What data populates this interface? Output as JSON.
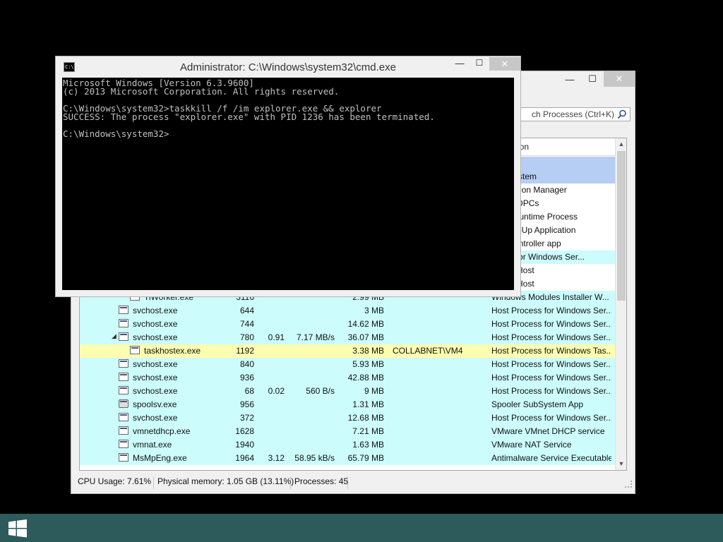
{
  "process_explorer": {
    "window_buttons": {
      "minimize": "—",
      "maximize": "☐",
      "close": "✕"
    },
    "search_placeholder": "ch Processes (Ctrl+K)",
    "header": {
      "description": "ion"
    },
    "rows": [
      {
        "name": "",
        "pid": "",
        "cpu": "",
        "io": "",
        "mem": "",
        "user": "",
        "desc": "",
        "style": "sel",
        "indent": 0,
        "icon": "none"
      },
      {
        "name": "",
        "pid": "",
        "cpu": "",
        "io": "",
        "mem": "",
        "user": "",
        "desc": "el & System",
        "style": "sel",
        "indent": 0,
        "icon": "none"
      },
      {
        "name": "",
        "pid": "",
        "cpu": "",
        "io": "",
        "mem": "",
        "user": "",
        "desc": "rs Session Manager",
        "style": "white",
        "indent": 0,
        "icon": "none"
      },
      {
        "name": "",
        "pid": "",
        "cpu": "",
        "io": "",
        "mem": "",
        "user": "",
        "desc": "ts and DPCs",
        "style": "white",
        "indent": 0,
        "icon": "none"
      },
      {
        "name": "",
        "pid": "",
        "cpu": "",
        "io": "",
        "mem": "",
        "user": "",
        "desc": "erver Runtime Process",
        "style": "white",
        "indent": 0,
        "icon": "none"
      },
      {
        "name": "",
        "pid": "",
        "cpu": "",
        "io": "",
        "mem": "",
        "user": "",
        "desc": "rs Start-Up Application",
        "style": "white",
        "indent": 0,
        "icon": "none"
      },
      {
        "name": "",
        "pid": "",
        "cpu": "",
        "io": "",
        "mem": "",
        "user": "",
        "desc": " and Controller app",
        "style": "white",
        "indent": 0,
        "icon": "none"
      },
      {
        "name": "",
        "pid": "",
        "cpu": "",
        "io": "",
        "mem": "",
        "user": "",
        "desc": "ocess for Windows Ser...",
        "style": "plain",
        "indent": 0,
        "icon": "none"
      },
      {
        "name": "",
        "pid": "",
        "cpu": "",
        "io": "",
        "mem": "",
        "user": "",
        "desc": "ovider Host",
        "style": "white",
        "indent": 0,
        "icon": "none"
      },
      {
        "name": "",
        "pid": "",
        "cpu": "",
        "io": "",
        "mem": "",
        "user": "",
        "desc": "ovider Host",
        "style": "white",
        "indent": 0,
        "icon": "none"
      },
      {
        "name": "TiWorker.exe",
        "pid": "3116",
        "cpu": "",
        "io": "",
        "mem": "2.99 MB",
        "user": "",
        "desc": "Windows Modules Installer W...",
        "style": "plain",
        "indent": 2,
        "icon": "app"
      },
      {
        "name": "svchost.exe",
        "pid": "644",
        "cpu": "",
        "io": "",
        "mem": "3 MB",
        "user": "",
        "desc": "Host Process for Windows Ser...",
        "style": "plain",
        "indent": 1,
        "icon": "app"
      },
      {
        "name": "svchost.exe",
        "pid": "744",
        "cpu": "",
        "io": "",
        "mem": "14.62 MB",
        "user": "",
        "desc": "Host Process for Windows Ser...",
        "style": "plain",
        "indent": 1,
        "icon": "app"
      },
      {
        "name": "svchost.exe",
        "pid": "780",
        "cpu": "0.91",
        "io": "7.17 MB/s",
        "mem": "36.07 MB",
        "user": "",
        "desc": "Host Process for Windows Ser...",
        "style": "plain",
        "indent": 1,
        "icon": "app",
        "expanded": true
      },
      {
        "name": "taskhostex.exe",
        "pid": "1192",
        "cpu": "",
        "io": "",
        "mem": "3.38 MB",
        "user": "COLLABNET\\VM4",
        "desc": "Host Process for Windows Tas...",
        "style": "user",
        "indent": 2,
        "icon": "app"
      },
      {
        "name": "svchost.exe",
        "pid": "840",
        "cpu": "",
        "io": "",
        "mem": "5.93 MB",
        "user": "",
        "desc": "Host Process for Windows Ser...",
        "style": "plain",
        "indent": 1,
        "icon": "app"
      },
      {
        "name": "svchost.exe",
        "pid": "936",
        "cpu": "",
        "io": "",
        "mem": "42.88 MB",
        "user": "",
        "desc": "Host Process for Windows Ser...",
        "style": "plain",
        "indent": 1,
        "icon": "app"
      },
      {
        "name": "svchost.exe",
        "pid": "68",
        "cpu": "0.02",
        "io": "560 B/s",
        "mem": "9 MB",
        "user": "",
        "desc": "Host Process for Windows Ser...",
        "style": "plain",
        "indent": 1,
        "icon": "app"
      },
      {
        "name": "spoolsv.exe",
        "pid": "956",
        "cpu": "",
        "io": "",
        "mem": "1.31 MB",
        "user": "",
        "desc": "Spooler SubSystem App",
        "style": "plain",
        "indent": 1,
        "icon": "printer"
      },
      {
        "name": "svchost.exe",
        "pid": "372",
        "cpu": "",
        "io": "",
        "mem": "12.68 MB",
        "user": "",
        "desc": "Host Process for Windows Ser...",
        "style": "plain",
        "indent": 1,
        "icon": "app"
      },
      {
        "name": "vmnetdhcp.exe",
        "pid": "1628",
        "cpu": "",
        "io": "",
        "mem": "7.21 MB",
        "user": "",
        "desc": "VMware VMnet DHCP service",
        "style": "plain",
        "indent": 1,
        "icon": "app"
      },
      {
        "name": "vmnat.exe",
        "pid": "1940",
        "cpu": "",
        "io": "",
        "mem": "1.63 MB",
        "user": "",
        "desc": "VMware NAT Service",
        "style": "plain",
        "indent": 1,
        "icon": "app"
      },
      {
        "name": "MsMpEng.exe",
        "pid": "1964",
        "cpu": "3.12",
        "io": "58.95 kB/s",
        "mem": "65.79 MB",
        "user": "",
        "desc": "Antimalware Service Executable",
        "style": "plain",
        "indent": 1,
        "icon": "app"
      }
    ],
    "status": {
      "cpu": "CPU Usage: 7.61%",
      "memory": "Physical memory: 1.05 GB (13.11%)",
      "processes": "Processes: 45"
    }
  },
  "cmd": {
    "title": "Administrator: C:\\Windows\\system32\\cmd.exe",
    "icon_label": "C:\\",
    "window_buttons": {
      "minimize": "—",
      "maximize": "☐",
      "close": "✕"
    },
    "console_text": "Microsoft Windows [Version 6.3.9600]\n(c) 2013 Microsoft Corporation. All rights reserved.\n\nC:\\Windows\\system32>taskkill /f /im explorer.exe && explorer\nSUCCESS: The process \"explorer.exe\" with PID 1236 has been terminated.\n\nC:\\Windows\\system32>"
  },
  "colors": {
    "taskbar": "#2d5b5b",
    "service_row": "#ccfcfc",
    "user_row": "#fdfdb0",
    "selected_row": "#b6cdf4"
  }
}
